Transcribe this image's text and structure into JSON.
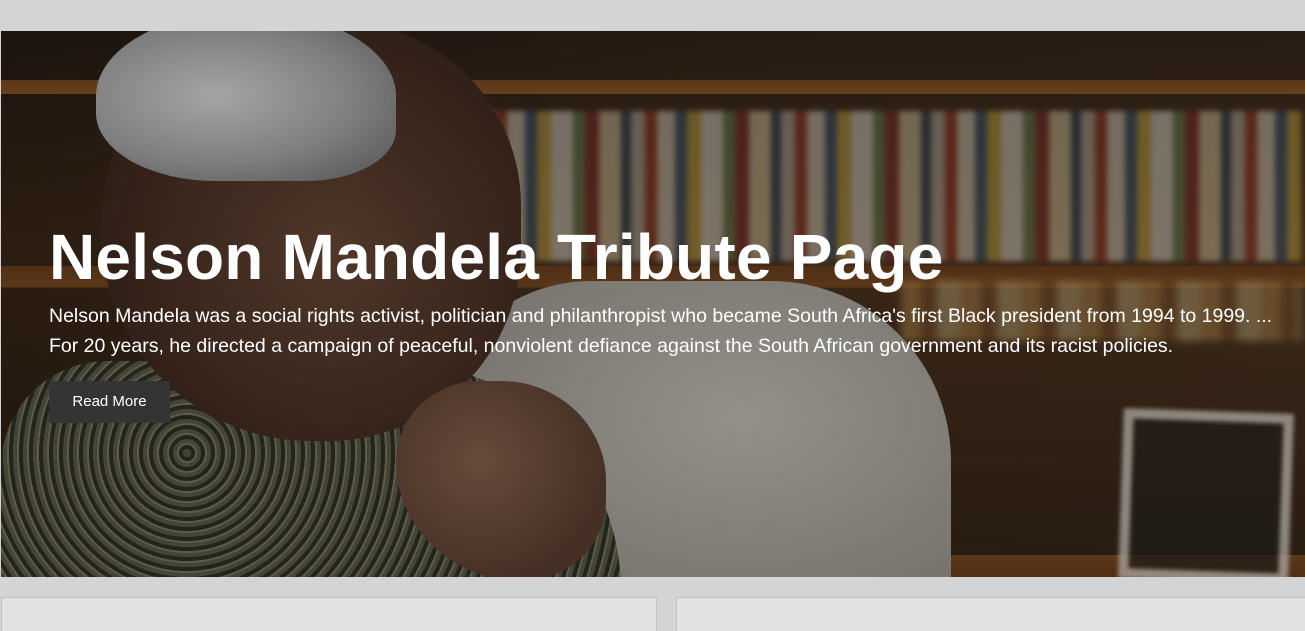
{
  "hero": {
    "title": "Nelson Mandela Tribute Page",
    "description": "Nelson Mandela was a social rights activist, politician and philanthropist who became South Africa's first Black president from 1994 to 1999. ... For 20 years, he directed a campaign of peaceful, nonviolent defiance against the South African government and its racist policies.",
    "button_label": "Read More"
  },
  "colors": {
    "page_background": "#d4d4d4",
    "button_background": "#343434",
    "text": "#ffffff",
    "card_background": "#e1e1e1"
  }
}
